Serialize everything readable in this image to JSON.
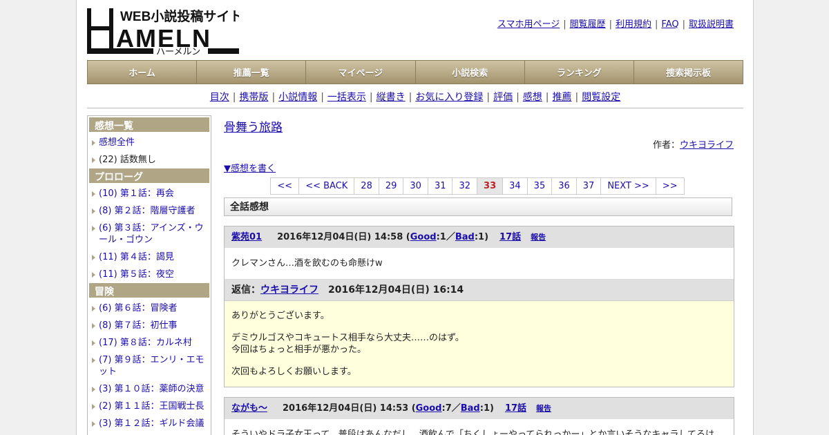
{
  "logo": {
    "tagline": "WEB小説投稿サイト",
    "main": "HAMELN",
    "kana": "ハーメルン"
  },
  "toplinks": [
    "スマホ用ページ",
    "閲覧履歴",
    "利用規約",
    "FAQ",
    "取扱説明書"
  ],
  "gnav": [
    "ホーム",
    "推薦一覧",
    "マイページ",
    "小説検索",
    "ランキング",
    "捜索掲示板"
  ],
  "subnav": [
    "目次",
    "携帯版",
    "小説情報",
    "一括表示",
    "縦書き",
    "お気に入り登録",
    "評価",
    "感想",
    "推薦",
    "閲覧設定"
  ],
  "sidebar": {
    "sections": [
      {
        "head": "感想一覧",
        "items": [
          {
            "text": "感想全件",
            "link": true
          },
          {
            "text": "(22) 話数無し",
            "link": false
          }
        ]
      },
      {
        "head": "プロローグ",
        "items": [
          {
            "text": "(10) 第１話：再会",
            "link": true
          },
          {
            "text": "(8) 第２話：階層守護者",
            "link": true
          },
          {
            "text": "(6) 第３話：アインズ・ウール・ゴウン",
            "link": true
          },
          {
            "text": "(11) 第４話：謁見",
            "link": true
          },
          {
            "text": "(11) 第５話：夜空",
            "link": true
          }
        ]
      },
      {
        "head": "冒険",
        "items": [
          {
            "text": "(6) 第６話：冒険者",
            "link": true
          },
          {
            "text": "(8) 第７話：初仕事",
            "link": true
          },
          {
            "text": "(17) 第８話：カルネ村",
            "link": true
          },
          {
            "text": "(7) 第９話：エンリ・エモット",
            "link": true
          },
          {
            "text": "(3) 第１０話：薬師の決意",
            "link": true
          },
          {
            "text": "(2) 第１１話：王国戦士長",
            "link": true
          },
          {
            "text": "(3) 第１２話：ギルド会議",
            "link": true
          }
        ]
      }
    ]
  },
  "novel": {
    "title": "骨舞う旅路",
    "author_label": "作者：",
    "author": "ウキヨライフ",
    "write_link": "▼感想を書く"
  },
  "pager": {
    "items": [
      "<<",
      "<< BACK",
      "28",
      "29",
      "30",
      "31",
      "32",
      "33",
      "34",
      "35",
      "36",
      "37",
      "NEXT >>",
      ">>"
    ],
    "current": "33"
  },
  "section_title": "全話感想",
  "comments": [
    {
      "name": "紫苑01",
      "date": "2016年12月04日(日) 14:58",
      "good_label": "Good",
      "good": "1",
      "bad_label": "Bad",
      "bad": "1",
      "episode": "17話",
      "report": "報告",
      "body": "クレマンさん…酒を飲むのも命懸けw",
      "reply": {
        "label": "返信：",
        "name": "ウキヨライフ",
        "date": "2016年12月04日(日) 16:14",
        "paragraphs": [
          "ありがとうございます。",
          "デミウルゴスやコキュートス相手なら大丈夫……のはず。\n今回はちょっと相手が悪かった。",
          "次回もよろしくお願いします。"
        ]
      }
    },
    {
      "name": "ながも～",
      "date": "2016年12月04日(日) 14:53",
      "good_label": "Good",
      "good": "7",
      "bad_label": "Bad",
      "bad": "1",
      "episode": "17話",
      "report": "報告",
      "body": "そういやドラ子女王って、普段はあんなだし、酒飲んで「ちくしょーやってられっかー」とか言いそうなキャラしてるけ"
    }
  ]
}
